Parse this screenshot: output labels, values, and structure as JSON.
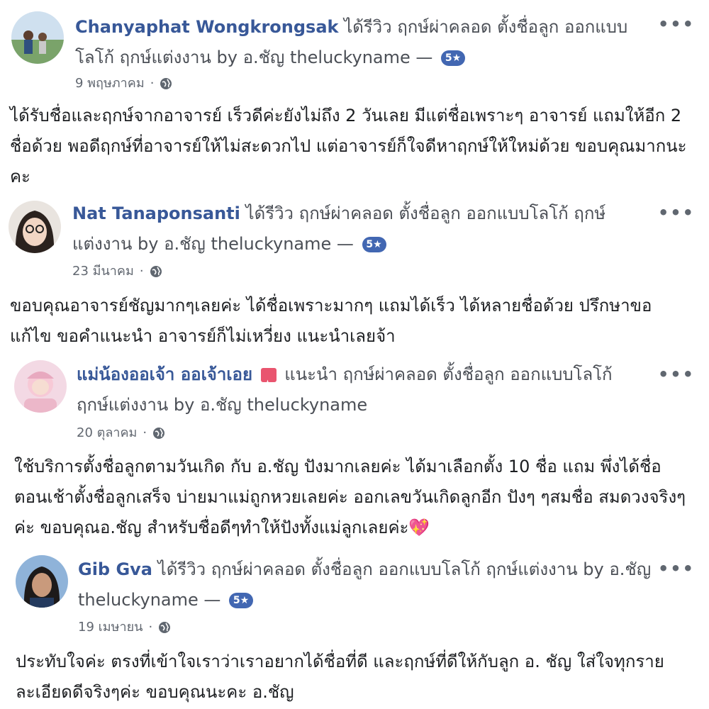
{
  "reviews": [
    {
      "name": "Chanyaphat Wongkrongsak",
      "action": "ได้รีวิว ฤกษ์ผ่าคลอด ตั้งชื่อลูก ออกแบบโลโก้ ฤกษ์แต่งงาน by อ.ชัญ theluckyname —",
      "badge": "5★",
      "date": "9 พฤษภาคม",
      "dot": "·",
      "more": "•••",
      "text": "ได้รับชื่อและฤกษ์จากอาจารย์ เร็วดีค่ะยังไม่ถึง 2 วันเลย มีแต่ชื่อเพราะๆ อาจารย์ แถมให้อีก 2 ชื่อด้วย พอดีฤกษ์ที่อาจารย์ให้ไม่สะดวกไป แต่อาจารย์ก็ใจดีหาฤกษ์ให้ใหม่ด้วย ขอบคุณมากนะคะ"
    },
    {
      "name": "Nat Tanaponsanti",
      "action": "ได้รีวิว ฤกษ์ผ่าคลอด ตั้งชื่อลูก ออกแบบโลโก้ ฤกษ์แต่งงาน by อ.ชัญ theluckyname —",
      "badge": "5★",
      "date": "23 มีนาคม",
      "dot": "·",
      "more": "•••",
      "text": "ขอบคุณอาจารย์ชัญมากๆเลยค่ะ ได้ชื่อเพราะมากๆ แถมได้เร็ว ได้หลายชื่อด้วย ปรึกษาขอแก้ไข ขอคำแนะนำ อาจารย์ก็ไม่เหวี่ยง แนะนำเลยจ้า"
    },
    {
      "name": "แม่น้องออเจ้า ออเจ้าเอย",
      "action": "แนะนำ ฤกษ์ผ่าคลอด ตั้งชื่อลูก ออกแบบโลโก้ ฤกษ์แต่งงาน by อ.ชัญ theluckyname",
      "date": "20 ตุลาคม",
      "dot": "·",
      "more": "•••",
      "text": "ใช้บริการตั้งชื่อลูกตามวันเกิด กับ อ.ชัญ ปังมากเลยค่ะ ได้มาเลือกตั้ง 10 ชื่อ แถม พึ่งได้ชื่อตอนเช้าตั้งชื่อลูกเสร็จ บ่ายมาแม่ถูกหวยเลยค่ะ ออกเลขวันเกิดลูกอีก ปังๆ ๆสมชื่อ สมดวงจริงๆค่ะ ขอบคุณอ.ชัญ สำหรับชื่อดีๆทำให้ปังทั้งแม่ลูกเลยค่ะ",
      "emoji": "💖"
    },
    {
      "name": "Gib Gva",
      "action": "ได้รีวิว ฤกษ์ผ่าคลอด ตั้งชื่อลูก ออกแบบโลโก้ ฤกษ์แต่งงาน by อ.ชัญ theluckyname —",
      "badge": "5★",
      "date": "19 เมษายน",
      "dot": "·",
      "more": "•••",
      "text": "ประทับใจค่ะ ตรงที่เข้าใจเราว่าเราอยากได้ชื่อที่ดี และฤกษ์ที่ดีให้กับลูก อ. ชัญ ใส่ใจทุกรายละเอียดดีจริงๆค่ะ ขอบคุณนะคะ อ.ชัญ"
    }
  ],
  "colors": {
    "name": "#385898",
    "badge": "#4267b2",
    "meta": "#616770"
  },
  "icons": {
    "privacy": "globe-icon",
    "options": "more-options-icon"
  }
}
